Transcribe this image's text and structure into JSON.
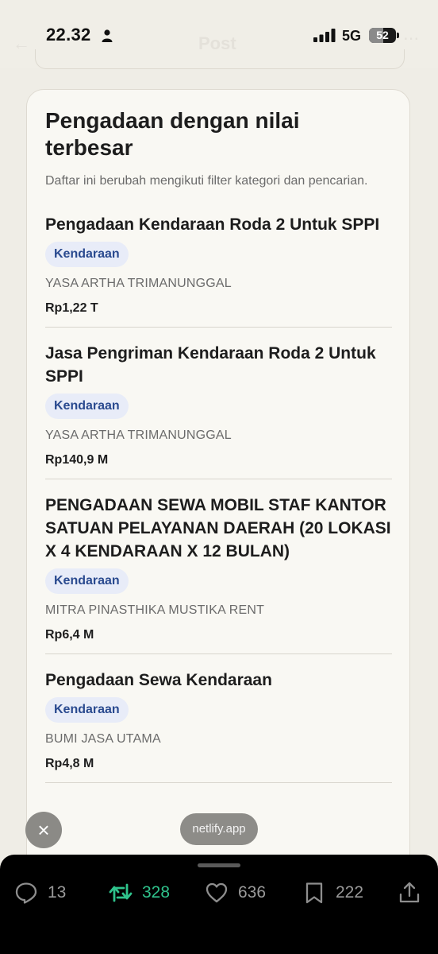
{
  "status_bar": {
    "time": "22.32",
    "network": "5G",
    "battery": "52",
    "battery_level": 0.52,
    "ghost_header_title": "Post"
  },
  "card": {
    "title": "Pengadaan dengan nilai terbesar",
    "description": "Daftar ini berubah mengikuti filter kategori dan pencarian.",
    "items": [
      {
        "title": "Pengadaan Kendaraan Roda 2 Untuk SPPI",
        "tag": "Kendaraan",
        "vendor": "YASA ARTHA TRIMANUNGGAL",
        "amount": "Rp1,22 T"
      },
      {
        "title": "Jasa Pengriman Kendaraan Roda 2 Untuk SPPI",
        "tag": "Kendaraan",
        "vendor": "YASA ARTHA TRIMANUNGGAL",
        "amount": "Rp140,9 M"
      },
      {
        "title": "PENGADAAN SEWA MOBIL STAF KANTOR SATUAN PELAYANAN DAERAH (20 LOKASI X 4 KENDARAAN X 12 BULAN)",
        "tag": "Kendaraan",
        "vendor": "MITRA PINASTHIKA MUSTIKA RENT",
        "amount": "Rp6,4 M"
      },
      {
        "title": "Pengadaan Sewa Kendaraan",
        "tag": "Kendaraan",
        "vendor": "BUMI JASA UTAMA",
        "amount": "Rp4,8 M"
      }
    ]
  },
  "overlay": {
    "close_symbol": "×",
    "url_pill": "netlify.app"
  },
  "actions": {
    "replies": "13",
    "reposts": "328",
    "likes": "636",
    "bookmarks": "222"
  },
  "colors": {
    "accent_repost": "#2fc38c",
    "tag_background": "#e8ecf8",
    "tag_text": "#2a4a8f"
  },
  "icons": [
    "person-icon",
    "signal-icon",
    "battery-icon",
    "close-icon",
    "reply-icon",
    "repost-icon",
    "heart-icon",
    "bookmark-icon",
    "share-icon"
  ]
}
